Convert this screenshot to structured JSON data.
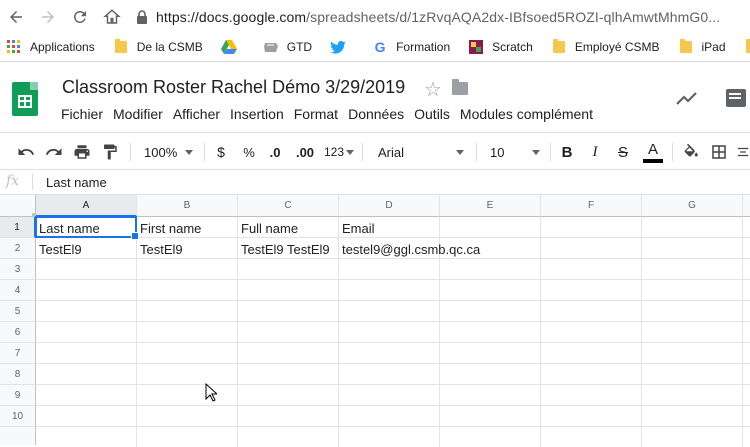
{
  "browser": {
    "url_domain": "https://docs.google.com",
    "url_rest": "/spreadsheets/d/1zRvqAQA2dx-IBfsoed5ROZI-qlhAmwtMhmG0..."
  },
  "bookmarks": [
    {
      "label": "Applications",
      "icon": "apps-grid-icon"
    },
    {
      "label": "De la CSMB",
      "icon": "folder-icon"
    },
    {
      "label": "",
      "icon": "google-drive-icon"
    },
    {
      "label": "GTD",
      "icon": "gtd-icon"
    },
    {
      "label": "",
      "icon": "twitter-icon"
    },
    {
      "label": "Formation",
      "icon": "google-icon"
    },
    {
      "label": "Scratch",
      "icon": "scratch-icon"
    },
    {
      "label": "Employé CSMB",
      "icon": "folder-icon"
    },
    {
      "label": "iPad",
      "icon": "folder-icon"
    }
  ],
  "document": {
    "title": "Classroom Roster Rachel Démo 3/29/2019",
    "menus": [
      "Fichier",
      "Modifier",
      "Afficher",
      "Insertion",
      "Format",
      "Données",
      "Outils",
      "Modules complément"
    ]
  },
  "toolbar": {
    "zoom": "100%",
    "currency": "$",
    "percent": "%",
    "dec_decrease": ".0",
    "dec_increase": ".00",
    "more_formats": "123",
    "font": "Arial",
    "font_size": "10",
    "bold": "B",
    "italic": "I",
    "strike": "S",
    "text_color": "A"
  },
  "formula_bar": {
    "fx": "fx",
    "value": "Last name"
  },
  "sheet": {
    "columns": [
      "A",
      "B",
      "C",
      "D",
      "E",
      "F",
      "G"
    ],
    "rows": [
      "1",
      "2",
      "3",
      "4",
      "5",
      "6",
      "7",
      "8",
      "9",
      "10"
    ],
    "cells": {
      "A1": "Last name",
      "B1": "First name",
      "C1": "Full name",
      "D1": "Email",
      "A2": "TestEl9",
      "B2": "TestEl9",
      "C2": "TestEl9 TestEl9",
      "D2": "testel9@ggl.csmb.qc.ca"
    },
    "selected_cell": "A1"
  },
  "colors": {
    "accent": "#1a73e8",
    "sheets_green": "#0f9d58"
  }
}
